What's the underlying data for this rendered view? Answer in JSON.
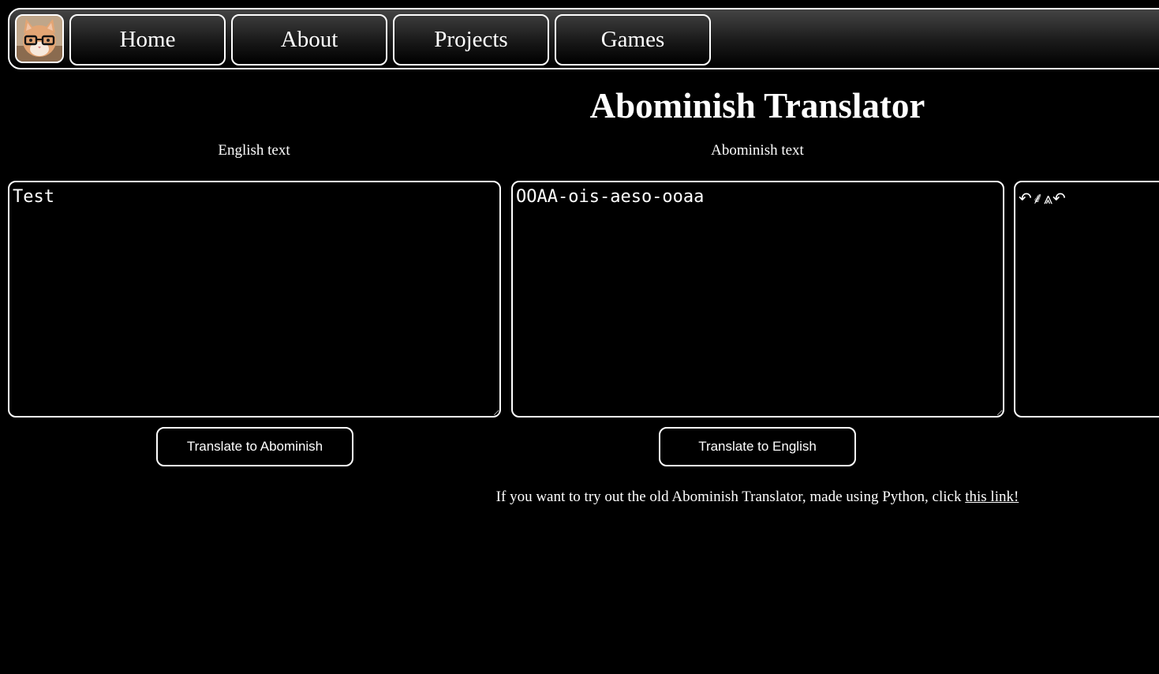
{
  "nav": {
    "logo_alt": "cat with glasses avatar",
    "items": [
      {
        "label": "Home"
      },
      {
        "label": "About"
      },
      {
        "label": "Projects"
      },
      {
        "label": "Games"
      }
    ]
  },
  "main": {
    "title": "Abominish Translator",
    "english_label": "English text",
    "abominish_label": "Abominish text",
    "english_value": "Test",
    "abominish_value": "OOAA-ois-aeso-ooaa",
    "symbol_value": "↶⸙⩓↶",
    "translate_to_abominish": "Translate to Abominish",
    "translate_to_english": "Translate to English"
  },
  "footer": {
    "text": "If you want to try out the old Abominish Translator, made using Python, click ",
    "link_text": "this link!"
  },
  "colors": {
    "background": "#000000",
    "foreground": "#ffffff"
  }
}
